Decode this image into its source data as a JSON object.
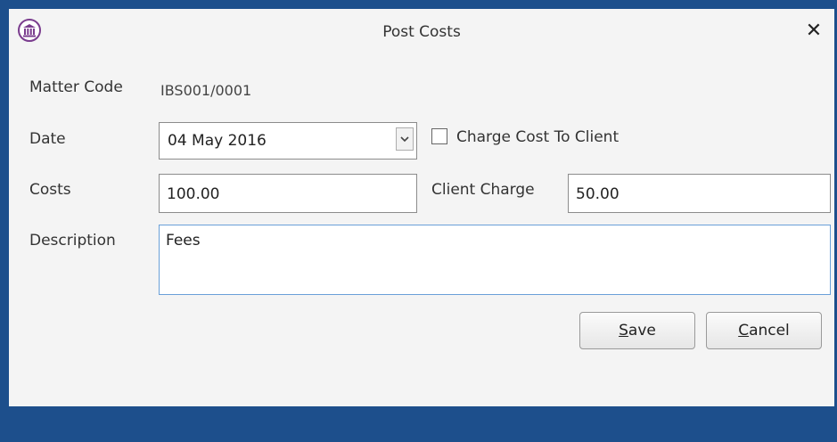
{
  "window": {
    "title": "Post Costs",
    "close_glyph": "✕",
    "app_icon": "bank-building-icon",
    "accent_color": "#1d4f8c"
  },
  "form": {
    "matter_code_label": "Matter Code",
    "matter_code_value": "IBS001/0001",
    "date_label": "Date",
    "date_value": "04 May 2016",
    "charge_cost_label": "Charge Cost To Client",
    "charge_cost_checked": false,
    "costs_label": "Costs",
    "costs_value": "100.00",
    "client_charge_label": "Client Charge",
    "client_charge_value": "50.00",
    "description_label": "Description",
    "description_value": "Fees"
  },
  "buttons": {
    "save_mnemonic": "S",
    "save_rest": "ave",
    "cancel_mnemonic": "C",
    "cancel_rest": "ancel"
  }
}
